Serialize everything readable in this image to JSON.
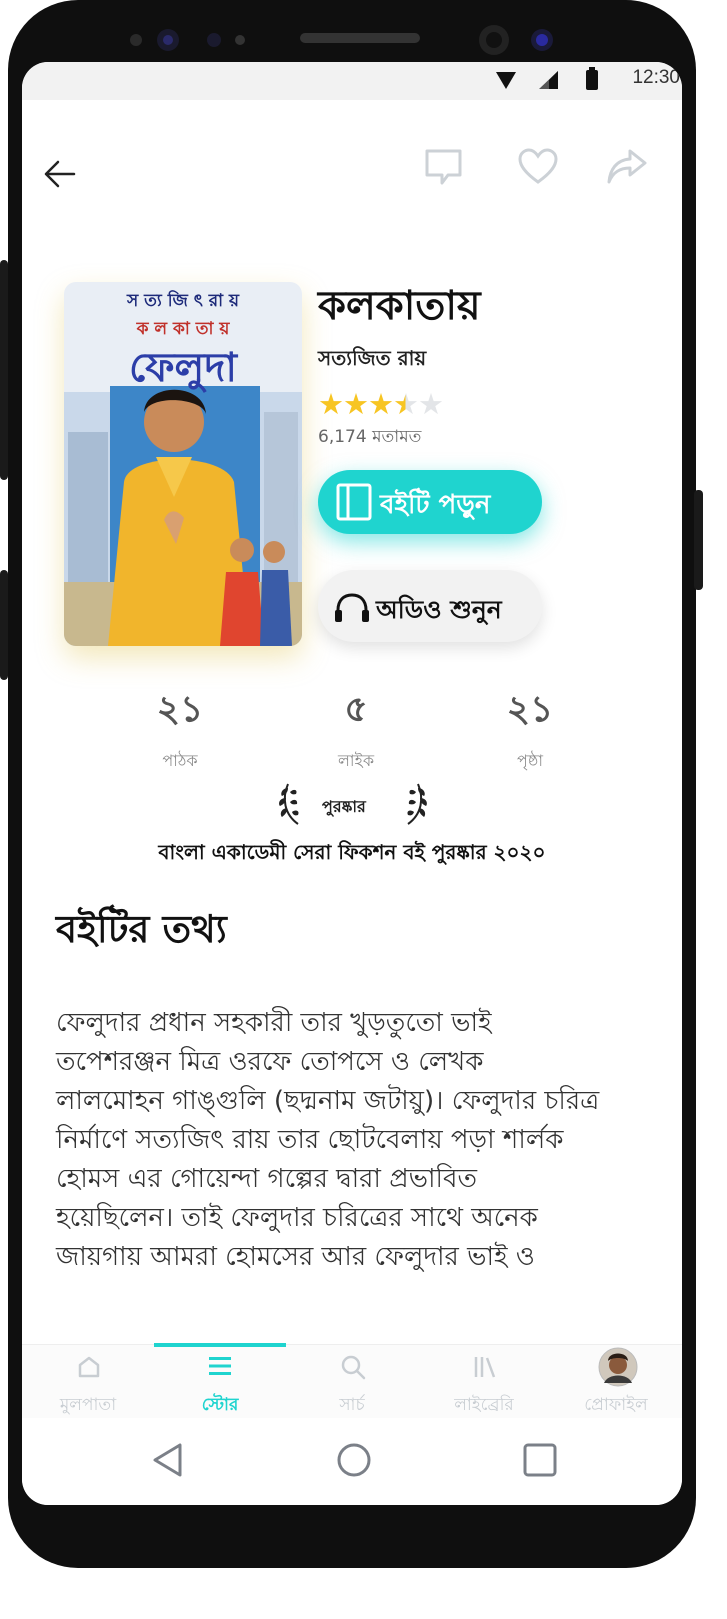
{
  "status": {
    "time": "12:30"
  },
  "book": {
    "title": "কলকাতায়",
    "author": "সত্যজিত রায়",
    "rating": 3.5,
    "reviews": "6,174 মতামত",
    "cover": {
      "top_text": "স ত্য জি ৎ   রা য়",
      "sub_text": "ক ল কা তা য়",
      "main_text": "ফেলুদা"
    }
  },
  "actions": {
    "read_label": "বইটি পড়ুন",
    "audio_label": "অডিও শুনুন"
  },
  "stats": [
    {
      "value": "২১",
      "label": "পাঠক"
    },
    {
      "value": "৫",
      "label": "লাইক"
    },
    {
      "value": "২১",
      "label": "পৃষ্ঠা"
    }
  ],
  "award": {
    "label": "পুরষ্কার",
    "text": "বাংলা একাডেমী সেরা ফিকশন বই পুরষ্কার ২০২০"
  },
  "info": {
    "title": "বইটির তথ্য",
    "lines": [
      "ফেলুদার প্রধান সহকারী তার খুড়তুতো ভাই",
      "তপেশরঞ্জন মিত্র ওরফে তোপসে ও লেখক",
      "লালমোহন গাঙ্গুলি (ছদ্মনাম জটায়ু)। ফেলুদার চরিত্র",
      "নির্মাণে সত্যজিৎ রায় তার ছোটবেলায় পড়া শার্লক",
      "হোমস এর গোয়েন্দা গল্পের দ্বারা প্রভাবিত",
      "হয়েছিলেন। তাই ফেলুদার চরিত্রের সাথে অনেক",
      "জায়গায় আমরা হোমসের আর ফেলুদার ভাই ও"
    ]
  },
  "nav": [
    {
      "label": "মুলপাতা",
      "icon": "home-icon"
    },
    {
      "label": "স্টোর",
      "icon": "menu-icon",
      "active": true
    },
    {
      "label": "সার্চ",
      "icon": "search-icon"
    },
    {
      "label": "লাইব্রেরি",
      "icon": "library-icon"
    },
    {
      "label": "প্রোফাইল",
      "icon": "avatar"
    }
  ],
  "colors": {
    "accent": "#1fd4cf",
    "star": "#f7c523"
  }
}
